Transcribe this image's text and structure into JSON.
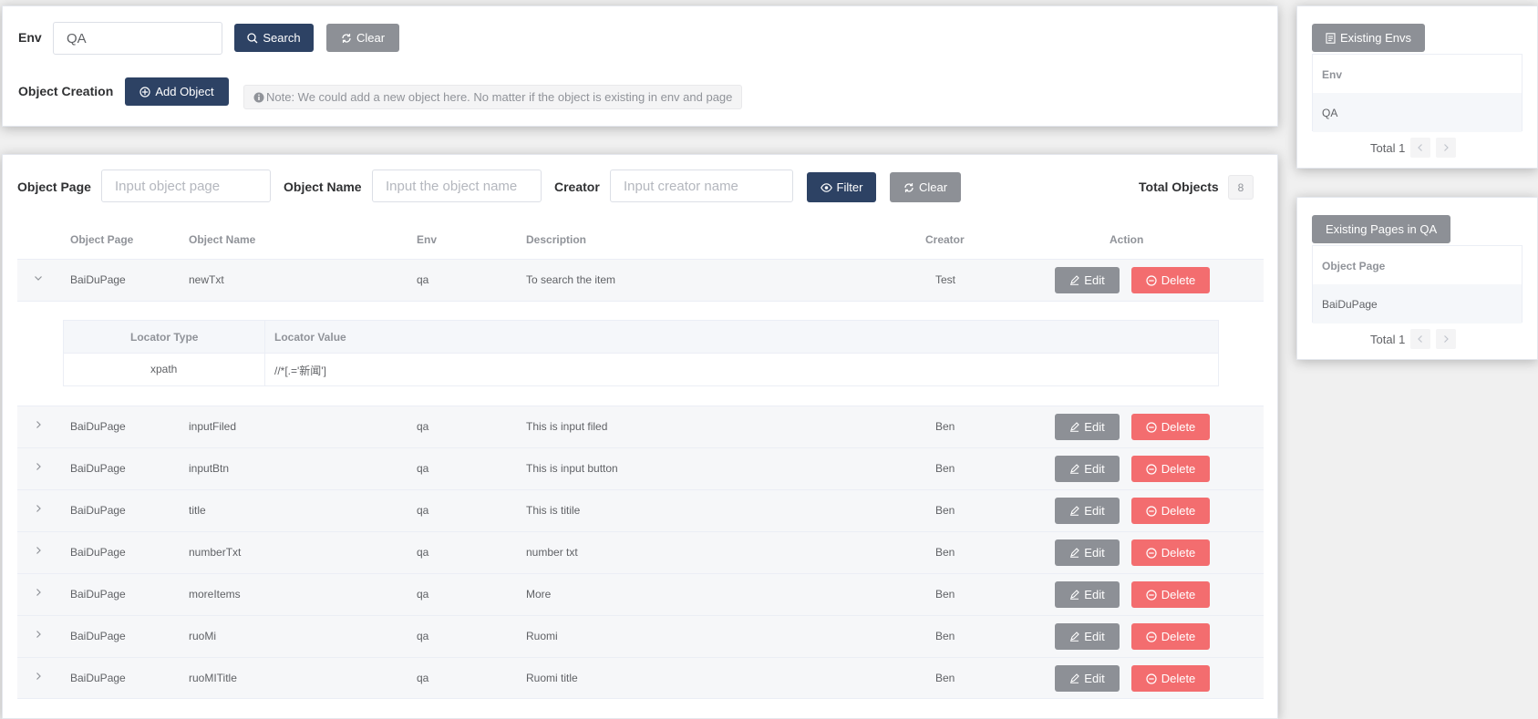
{
  "top": {
    "env_label": "Env",
    "env_value": "QA",
    "search_label": "Search",
    "clear_label": "Clear",
    "object_creation_label": "Object Creation",
    "add_object_label": "Add Object",
    "note": "Note: We could add a new object here. No matter if the object is existing in env and page"
  },
  "filters": {
    "object_page_label": "Object Page",
    "object_page_placeholder": "Input object page",
    "object_name_label": "Object Name",
    "object_name_placeholder": "Input the object name",
    "creator_label": "Creator",
    "creator_placeholder": "Input creator name",
    "filter_label": "Filter",
    "clear_label": "Clear",
    "total_objects_label": "Total Objects",
    "total_objects_count": "8"
  },
  "table": {
    "headers": [
      "Object Page",
      "Object Name",
      "Env",
      "Description",
      "Creator",
      "Action"
    ],
    "edit_label": "Edit",
    "delete_label": "Delete",
    "rows": [
      {
        "page": "BaiDuPage",
        "name": "newTxt",
        "env": "qa",
        "description": "To search the item",
        "creator": "Test",
        "expanded": true
      },
      {
        "page": "BaiDuPage",
        "name": "inputFiled",
        "env": "qa",
        "description": "This is input filed",
        "creator": "Ben"
      },
      {
        "page": "BaiDuPage",
        "name": "inputBtn",
        "env": "qa",
        "description": "This is input button",
        "creator": "Ben"
      },
      {
        "page": "BaiDuPage",
        "name": "title",
        "env": "qa",
        "description": "This is titile",
        "creator": "Ben"
      },
      {
        "page": "BaiDuPage",
        "name": "numberTxt",
        "env": "qa",
        "description": "number txt",
        "creator": "Ben"
      },
      {
        "page": "BaiDuPage",
        "name": "moreItems",
        "env": "qa",
        "description": "More",
        "creator": "Ben"
      },
      {
        "page": "BaiDuPage",
        "name": "ruoMi",
        "env": "qa",
        "description": "Ruomi",
        "creator": "Ben"
      },
      {
        "page": "BaiDuPage",
        "name": "ruoMITitle",
        "env": "qa",
        "description": "Ruomi title",
        "creator": "Ben"
      }
    ],
    "expanded_detail": {
      "headers": [
        "Locator Type",
        "Locator Value"
      ],
      "row": {
        "type": "xpath",
        "value": "//*[.='新闻']"
      }
    }
  },
  "side": {
    "envs": {
      "title": "Existing Envs",
      "header": "Env",
      "items": [
        "QA"
      ],
      "total": "Total 1"
    },
    "pages": {
      "title": "Existing Pages in QA",
      "header": "Object Page",
      "items": [
        "BaiDuPage"
      ],
      "total": "Total 1"
    }
  },
  "colors": {
    "primary_dark": "#2d4264",
    "gray_button": "#8d9096",
    "danger": "#f36d6f"
  }
}
